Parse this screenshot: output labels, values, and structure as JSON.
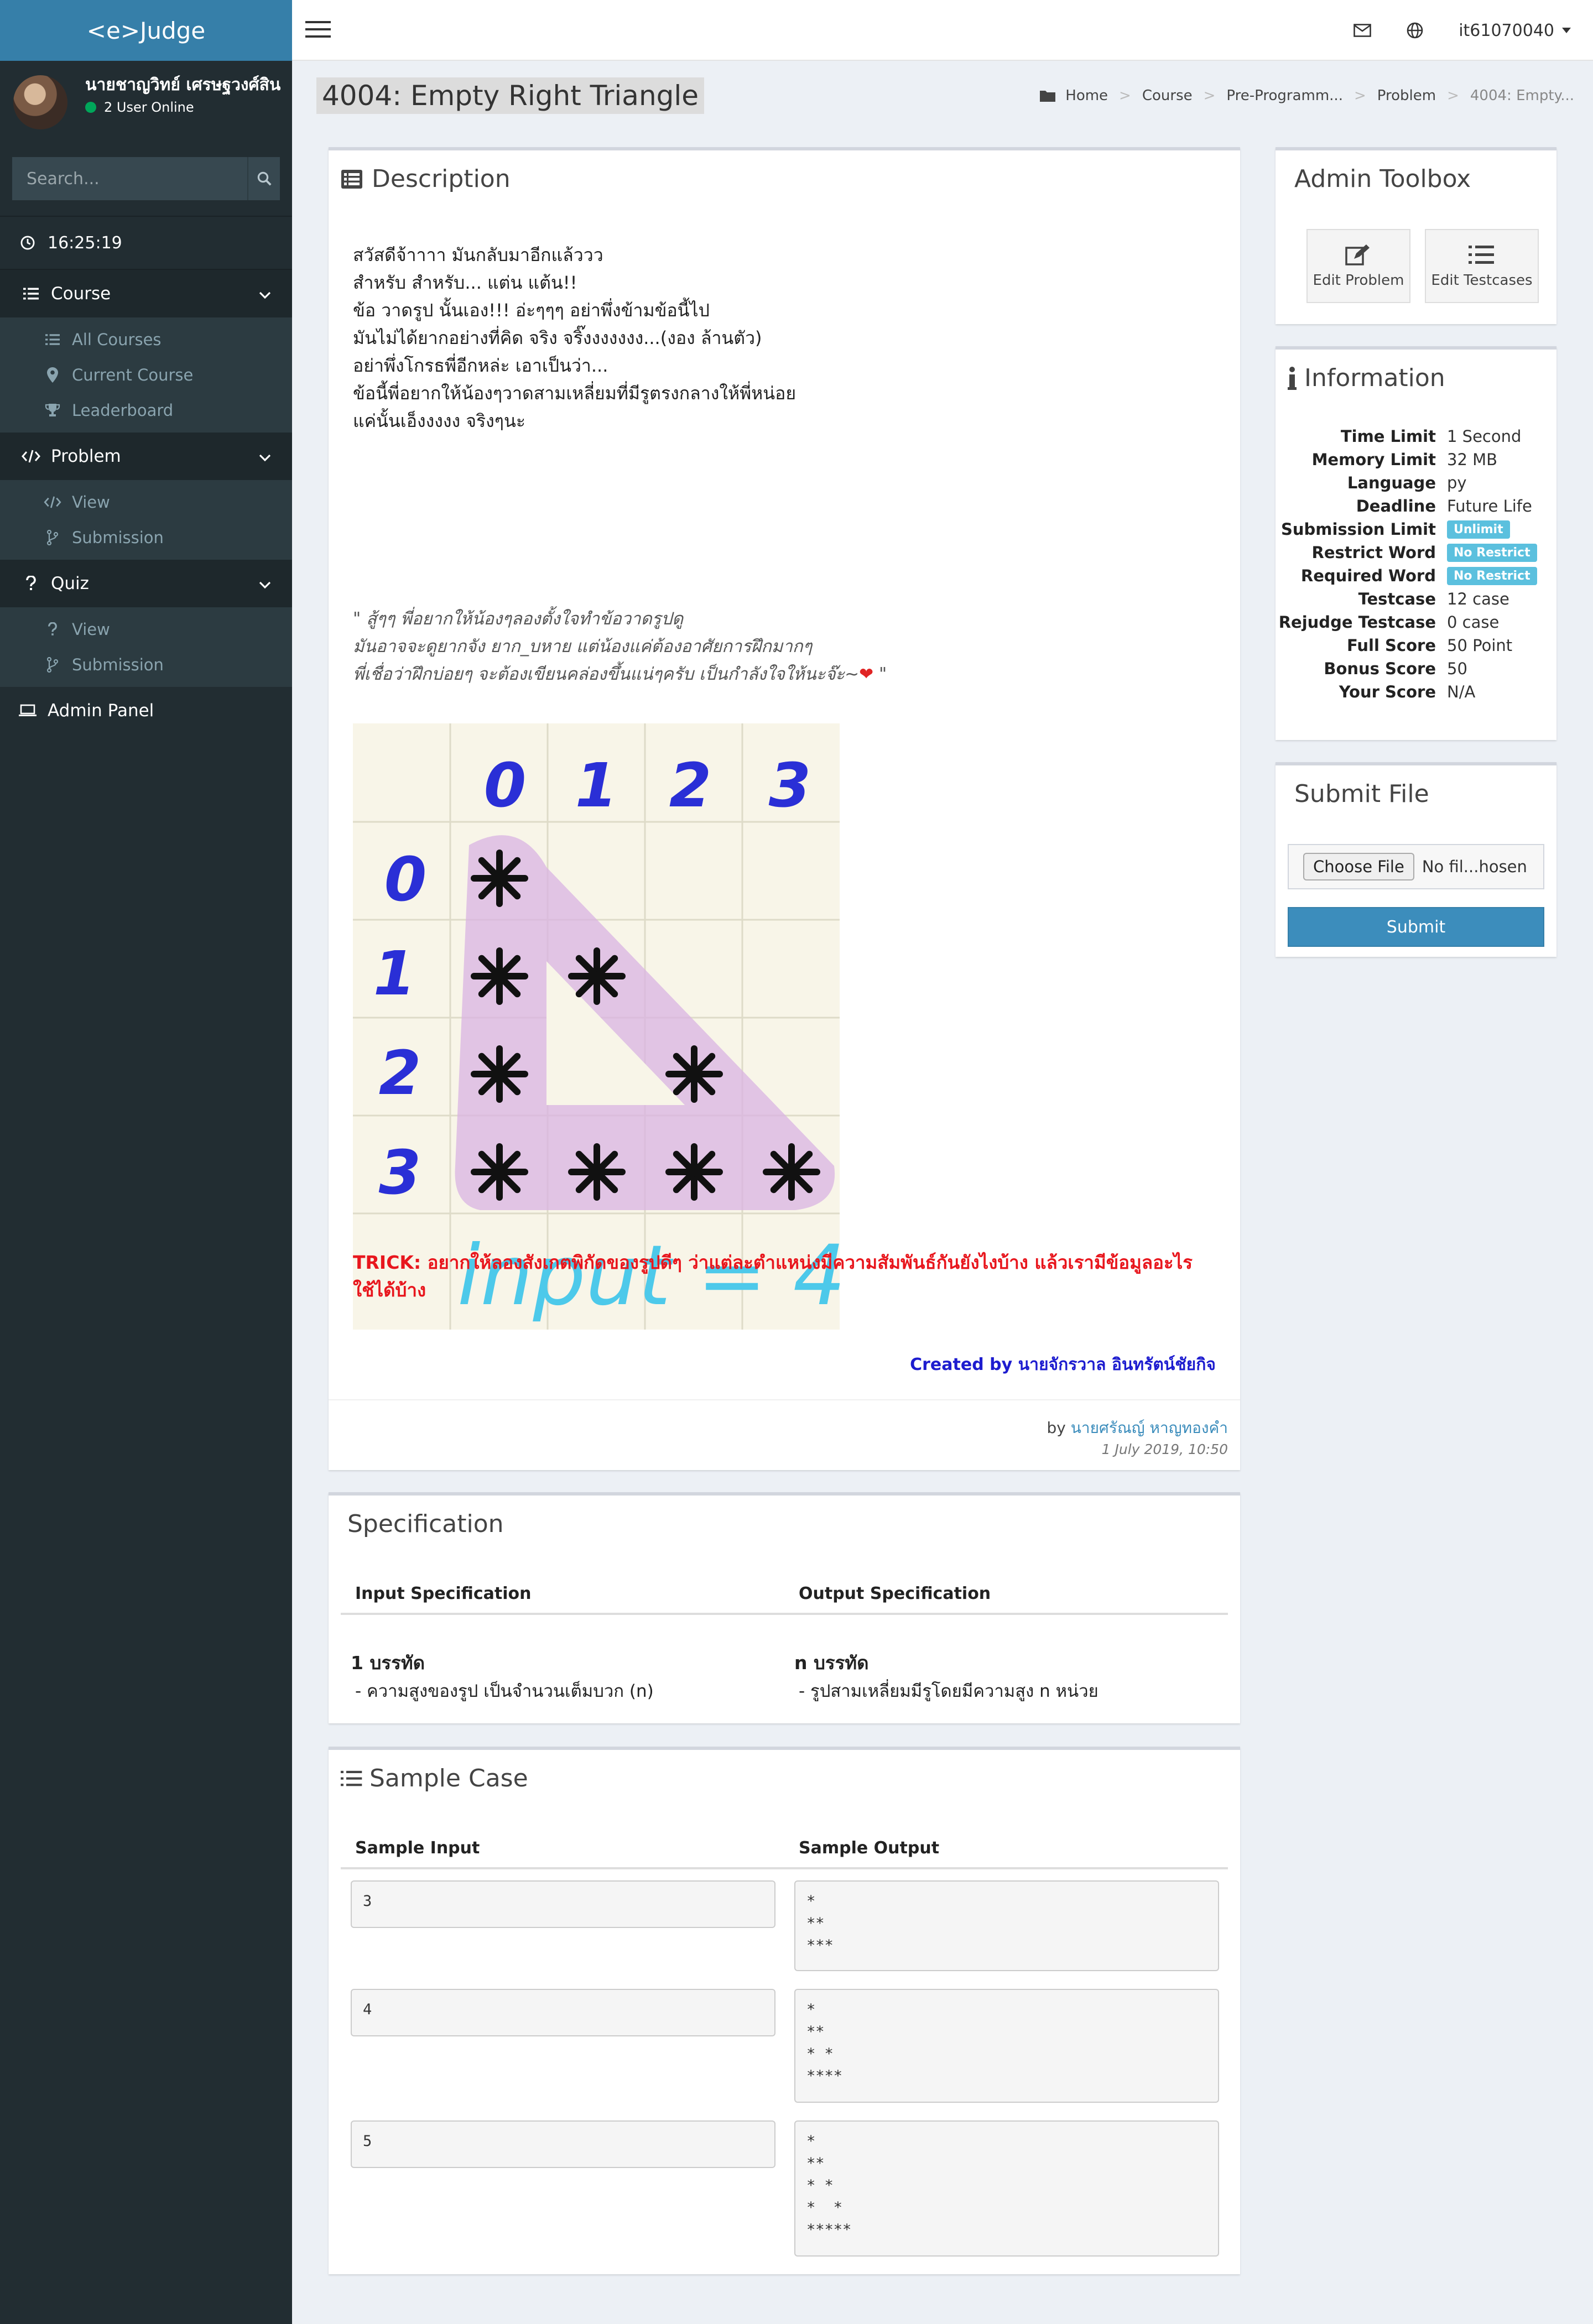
{
  "app": {
    "logo": "<e>Judge"
  },
  "user": {
    "name": "นายชาญวิทย์ เศรษฐวงศ์สิน",
    "online": "2 User Online"
  },
  "search": {
    "placeholder": "Search..."
  },
  "clock": "16:25:19",
  "sidebar": {
    "course": {
      "label": "Course",
      "items": [
        "All Courses",
        "Current Course",
        "Leaderboard"
      ]
    },
    "problem": {
      "label": "Problem",
      "items": [
        "View",
        "Submission"
      ]
    },
    "quiz": {
      "label": "Quiz",
      "items": [
        "View",
        "Submission"
      ]
    },
    "admin_panel": "Admin Panel"
  },
  "navbar": {
    "username": "it61070040"
  },
  "page": {
    "title": "4004: Empty Right Triangle"
  },
  "breadcrumb": [
    "Home",
    "Course",
    "Pre-Programm...",
    "Problem",
    "4004: Empty..."
  ],
  "description": {
    "title": "Description",
    "lines": [
      "สวัสดีจ้าาาา มันกลับมาอีกแล้ววว",
      "สำหรับ สำหรับ... แต่น แต้น!!",
      "ข้อ วาดรูป นั้นเอง!!! อ่ะๆๆๆ อย่าพึ่งข้ามข้อนี้ไป",
      "มันไม่ได้ยากอย่างที่คิด จริง จริ๊งงงงงงง...(งอง ล้านตัว)",
      "อย่าพึ่งโกรธพี่อีกหล่ะ เอาเป็นว่า...",
      "ข้อนี้พี่อยากให้น้องๆวาดสามเหลี่ยมที่มีรูตรงกลางให้พี่หน่อย",
      "แค่นั้นเอ็งงงงง จริงๆนะ"
    ],
    "quote_lines": [
      "\" สู้ๆๆ พี่อยากให้น้องๆลองตั้งใจทำข้อวาดรูปดู",
      "มันอาจจะดูยากจัง ยาก_บหาย แต่น้องแค่ต้องอาศัยการฝึกมากๆ",
      "พี่เชื่อว่าฝึกบ่อยๆ จะต้องเขียนคล่องขึ้นแน่ๆครับ เป็นกำลังใจให้นะจ๊ะ~"
    ],
    "quote_end": " \"",
    "drawing": {
      "cols": [
        "0",
        "1",
        "2",
        "3"
      ],
      "rows": [
        "0",
        "1",
        "2",
        "3"
      ],
      "caption": "input = 4"
    },
    "trick": "TRICK: อยากให้ลองสังเกตพิกัดของรูปดีๆ ว่าแต่ละตำแหน่งมีความสัมพันธ์กันยังไงบ้าง แล้วเรามีข้อมูลอะไรใช้ได้บ้าง",
    "created_by": "Created by นายจักรวาล อินทรัตน์ชัยกิจ",
    "by_prefix": "by ",
    "author": "นายศรัณญ์ หาญทองคำ",
    "date": "1 July 2019, 10:50"
  },
  "admin_toolbox": {
    "title": "Admin Toolbox",
    "edit_problem": "Edit Problem",
    "edit_testcases": "Edit Testcases"
  },
  "information": {
    "title": "Information",
    "rows": [
      {
        "label": "Time Limit",
        "value": "1 Second"
      },
      {
        "label": "Memory Limit",
        "value": "32 MB"
      },
      {
        "label": "Language",
        "value": "py"
      },
      {
        "label": "Deadline",
        "value": "Future Life"
      },
      {
        "label": "Submission Limit",
        "value": "Unlimit"
      },
      {
        "label": "Restrict Word",
        "value": "No Restrict"
      },
      {
        "label": "Required Word",
        "value": "No Restrict"
      },
      {
        "label": "Testcase",
        "value": "12 case"
      },
      {
        "label": "Rejudge Testcase",
        "value": "0 case"
      },
      {
        "label": "Full Score",
        "value": "50 Point"
      },
      {
        "label": "Bonus Score",
        "value": "50"
      },
      {
        "label": "Your Score",
        "value": "N/A"
      }
    ]
  },
  "submit_file": {
    "title": "Submit File",
    "choose": "Choose File",
    "no_file": "No fil...hosen",
    "submit": "Submit"
  },
  "specification": {
    "title": "Specification",
    "input_head": "Input Specification",
    "output_head": "Output Specification",
    "input_title": "1 บรรทัด",
    "input_desc": "- ความสูงของรูป เป็นจำนวนเต็มบวก (n)",
    "output_title": "n บรรทัด",
    "output_desc": "- รูปสามเหลี่ยมมีรูโดยมีความสูง n หน่วย"
  },
  "sample_case": {
    "title": "Sample Case",
    "input_head": "Sample Input",
    "output_head": "Sample Output",
    "cases": [
      {
        "input": "3",
        "output": "*\n**\n***"
      },
      {
        "input": "4",
        "output": "*\n**\n* *\n****"
      },
      {
        "input": "5",
        "output": "*\n**\n* *\n*  *\n*****"
      }
    ]
  },
  "colors": {
    "sidebar": "#222d32",
    "logo_bar": "#367fa9",
    "primary": "#3c8dbc",
    "badge": "#5bc0de",
    "trick": "#e8161d",
    "created": "#1d1ccf"
  }
}
